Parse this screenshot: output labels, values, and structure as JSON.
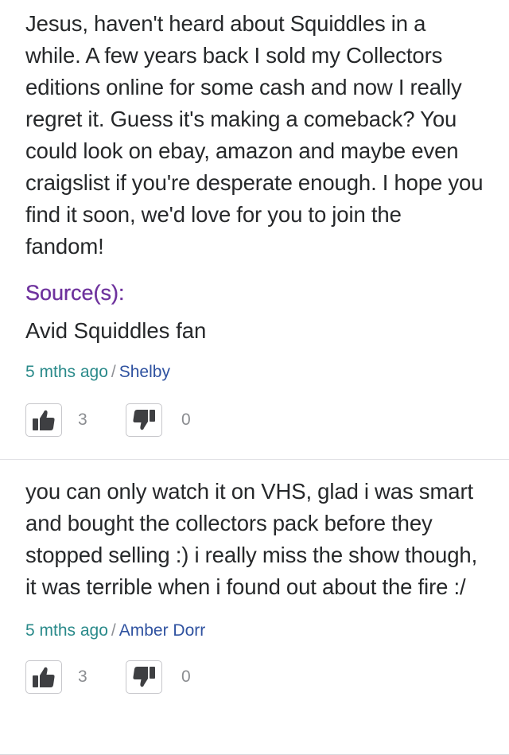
{
  "answers": [
    {
      "text": "Jesus, haven't heard about Squiddles in a while. A few years back I sold my Collectors editions online for some cash and now I really regret it. Guess it's making a comeback? You could look on ebay, amazon and maybe even craigslist if you're desperate enough. I hope you find it soon, we'd love for you to join the fandom!",
      "source_label": "Source(s):",
      "source_text": "Avid Squiddles fan",
      "time": "5 mths ago",
      "separator": "/",
      "author": "Shelby",
      "thumbs_up_count": "3",
      "thumbs_down_count": "0"
    },
    {
      "text": "you can only watch it on VHS, glad i was smart and bought the collectors pack before they stopped selling :) i really miss the show though, it was terrible when i found out about the fire :/",
      "time": "5 mths ago",
      "separator": "/",
      "author": "Amber Dorr",
      "thumbs_up_count": "3",
      "thumbs_down_count": "0"
    }
  ],
  "icons": {
    "thumbs_up": "thumbs-up-icon",
    "thumbs_down": "thumbs-down-icon"
  },
  "colors": {
    "source_label": "#6e329d",
    "timestamp": "#2a8a8a",
    "author_link": "#2f52a0",
    "icon": "#3e3f42",
    "button_border": "#c6c6ca"
  }
}
